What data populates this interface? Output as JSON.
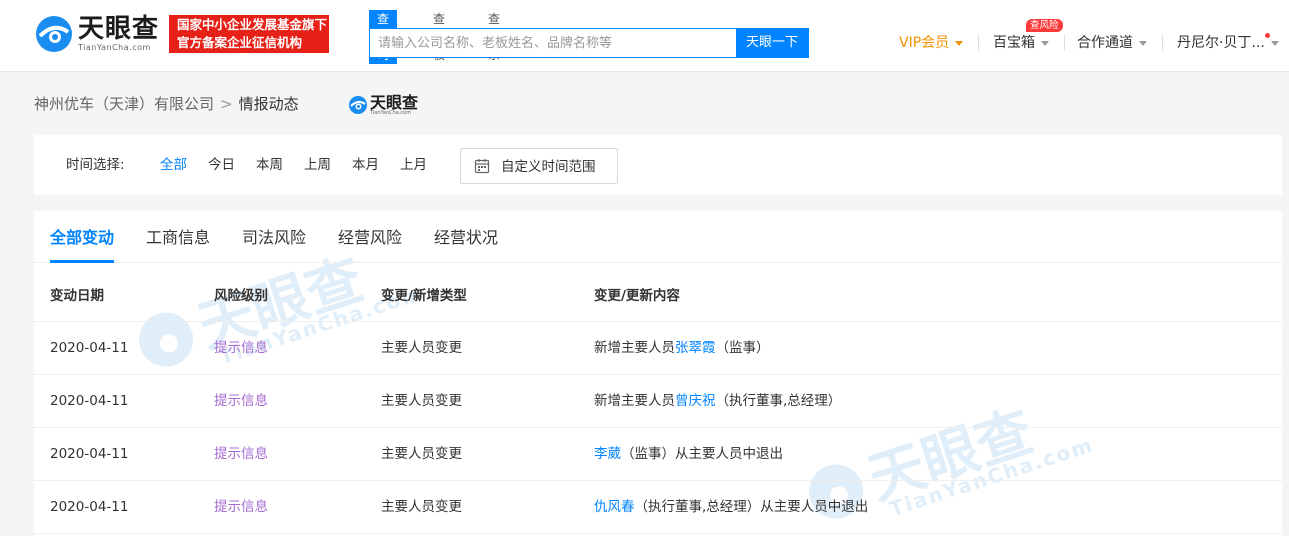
{
  "header": {
    "logo_text": "天眼查",
    "logo_sub": "TianYanCha.com",
    "badge_line1": "国家中小企业发展基金旗下",
    "badge_line2": "官方备案企业征信机构",
    "search_tabs": [
      "查公司",
      "查老板",
      "查关系"
    ],
    "search_placeholder": "请输入公司名称、老板姓名、品牌名称等",
    "search_button": "天眼一下",
    "nav": {
      "vip": "VIP会员",
      "treasure": "百宝箱",
      "risk_tag": "查风险",
      "partner": "合作通道",
      "user": "丹尼尔·贝丁..."
    },
    "colors": {
      "brand": "#0084ff",
      "vip": "#f09200",
      "badge_bg": "#e62117",
      "risk_level": "#a66bd3"
    }
  },
  "breadcrumb": {
    "company": "神州优车（天津）有限公司",
    "separator": ">",
    "current": "情报动态",
    "logo_text": "天眼查",
    "logo_sub": "TianYanCha.com"
  },
  "filter": {
    "label": "时间选择:",
    "options": [
      "全部",
      "今日",
      "本周",
      "上周",
      "本月",
      "上月"
    ],
    "active_option": "全部",
    "custom_range": "自定义时间范围"
  },
  "tabs": [
    "全部变动",
    "工商信息",
    "司法风险",
    "经营风险",
    "经营状况"
  ],
  "active_tab": "全部变动",
  "table": {
    "headers": [
      "变动日期",
      "风险级别",
      "变更/新增类型",
      "变更/更新内容"
    ],
    "rows": [
      {
        "date": "2020-04-11",
        "risk": "提示信息",
        "type": "主要人员变更",
        "prefix": "新增主要人员",
        "person": "张翠霞",
        "suffix": "（监事）"
      },
      {
        "date": "2020-04-11",
        "risk": "提示信息",
        "type": "主要人员变更",
        "prefix": "新增主要人员",
        "person": "曾庆祝",
        "suffix": "（执行董事,总经理）"
      },
      {
        "date": "2020-04-11",
        "risk": "提示信息",
        "type": "主要人员变更",
        "prefix": "",
        "person": "李葳",
        "suffix": "（监事）从主要人员中退出"
      },
      {
        "date": "2020-04-11",
        "risk": "提示信息",
        "type": "主要人员变更",
        "prefix": "",
        "person": "仇风春",
        "suffix": "（执行董事,总经理）从主要人员中退出"
      }
    ]
  },
  "watermark": {
    "text": "天眼查",
    "sub": "TianYanCha.com"
  }
}
